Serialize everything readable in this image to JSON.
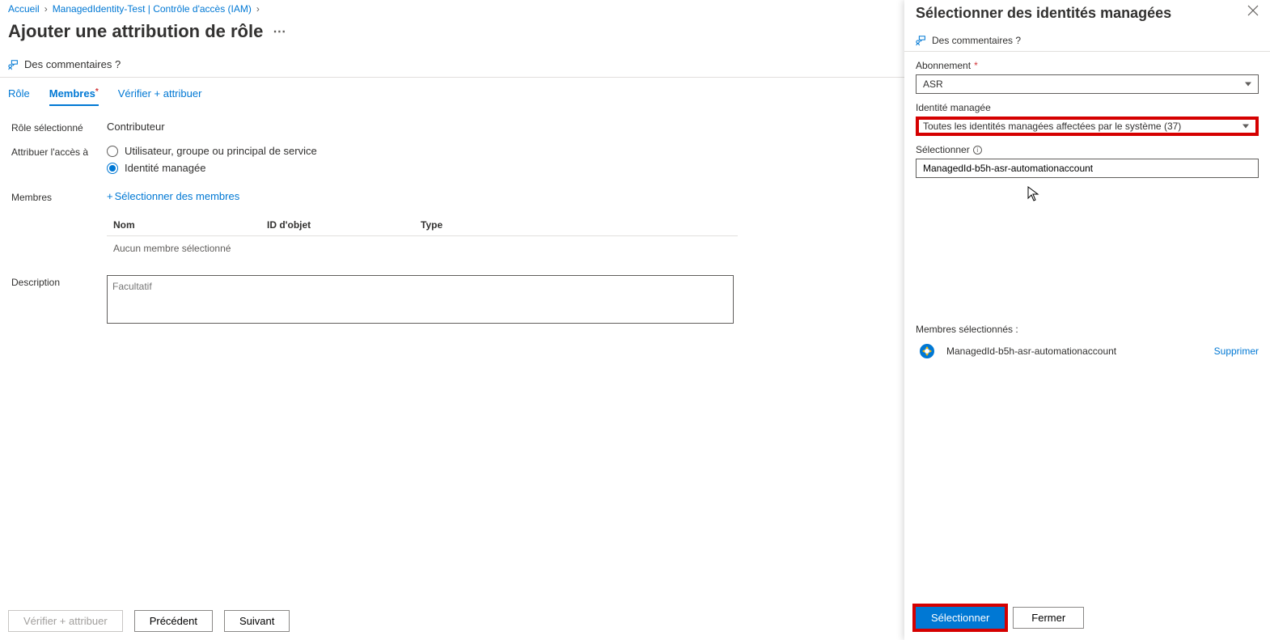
{
  "breadcrumb": {
    "home": "Accueil",
    "item1": "ManagedIdentity-Test | Contrôle d'accès (IAM)"
  },
  "page_title": "Ajouter une attribution de rôle",
  "commands": {
    "feedback": "Des commentaires ?"
  },
  "tabs": {
    "role": "Rôle",
    "members": "Membres",
    "review": "Vérifier + attribuer"
  },
  "form": {
    "selected_role_label": "Rôle sélectionné",
    "selected_role_value": "Contributeur",
    "assign_access_label": "Attribuer l'accès à",
    "radio_user": "Utilisateur, groupe ou principal de service",
    "radio_mi": "Identité managée",
    "members_label": "Membres",
    "select_members_link": "Sélectionner des membres",
    "table": {
      "col_name": "Nom",
      "col_id": "ID d'objet",
      "col_type": "Type",
      "empty": "Aucun membre sélectionné"
    },
    "description_label": "Description",
    "description_placeholder": "Facultatif"
  },
  "footer": {
    "review": "Vérifier + attribuer",
    "prev": "Précédent",
    "next": "Suivant"
  },
  "panel": {
    "title": "Sélectionner des identités managées",
    "feedback": "Des commentaires ?",
    "subscription_label": "Abonnement",
    "subscription_value": "ASR",
    "mi_label": "Identité managée",
    "mi_value": "Toutes les identités managées affectées par le système (37)",
    "select_label": "Sélectionner",
    "select_value": "ManagedId-b5h-asr-automationaccount",
    "selected_members_label": "Membres sélectionnés :",
    "selected_member_name": "ManagedId-b5h-asr-automationaccount",
    "remove_link": "Supprimer",
    "btn_select": "Sélectionner",
    "btn_close": "Fermer"
  }
}
